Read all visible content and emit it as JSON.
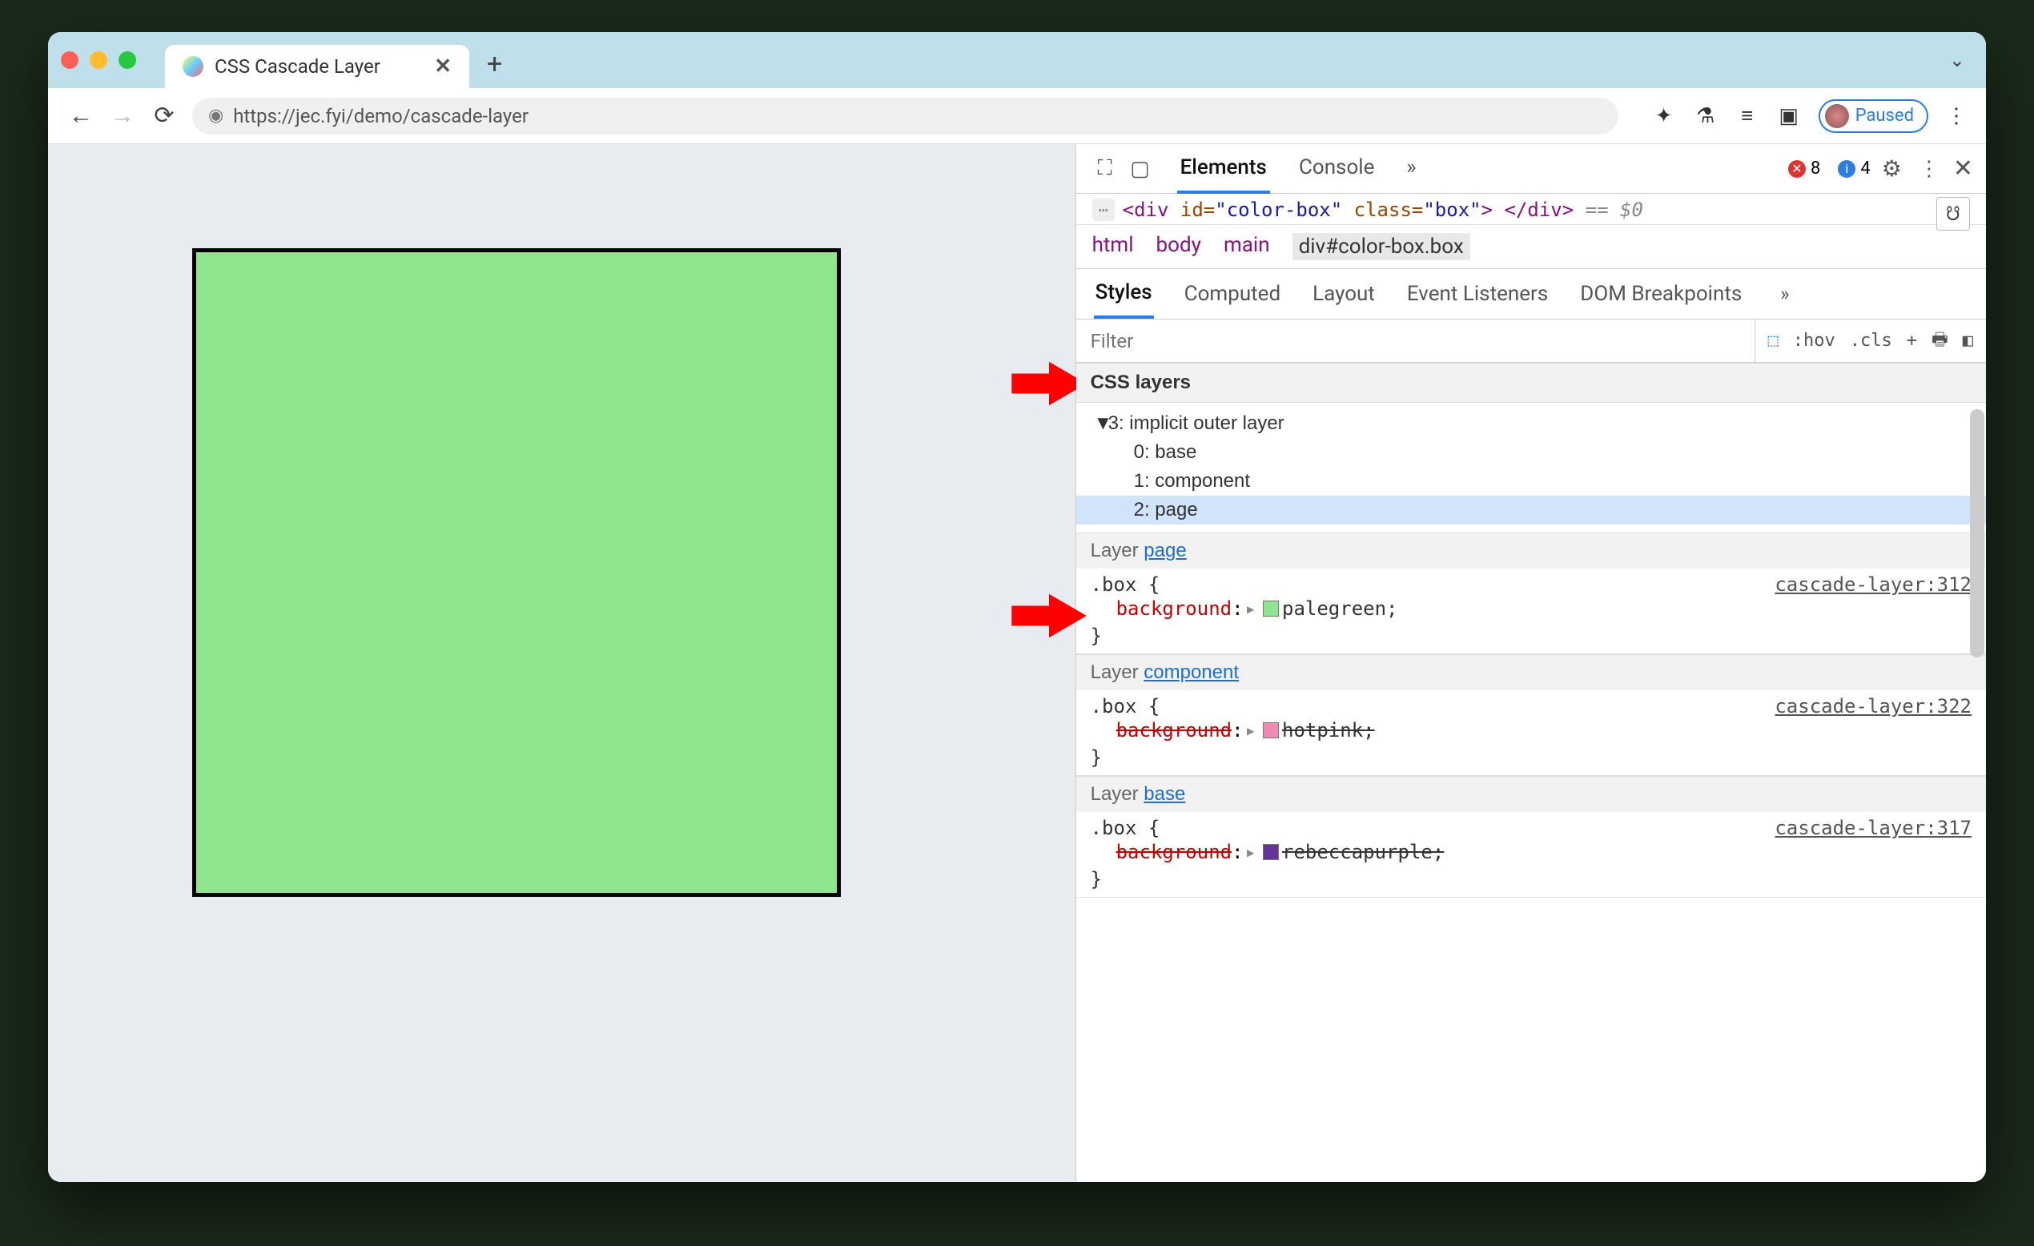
{
  "tab": {
    "title": "CSS Cascade Layer",
    "close": "✕",
    "new": "+"
  },
  "urlbar": {
    "url": "https://jec.fyi/demo/cascade-layer",
    "paused": "Paused"
  },
  "devtools": {
    "tabs": {
      "elements": "Elements",
      "console": "Console"
    },
    "errors": "8",
    "info": "4",
    "more": "»",
    "element_line_prefix": "<div ",
    "element_id_attr": "id=",
    "element_id_val": "\"color-box\"",
    "element_class_attr": " class=",
    "element_class_val": "\"box\"",
    "element_close": "> </div>",
    "eq0": " == $0",
    "breadcrumb": {
      "html": "html",
      "body": "body",
      "main": "main",
      "sel": "div#color-box.box"
    }
  },
  "styles": {
    "tabs": {
      "styles": "Styles",
      "computed": "Computed",
      "layout": "Layout",
      "events": "Event Listeners",
      "dom": "DOM Breakpoints",
      "more": "»"
    },
    "filter_placeholder": "Filter",
    "tools": {
      "hov": ":hov",
      "cls": ".cls",
      "plus": "+"
    },
    "css_layers_header": "CSS layers",
    "layer_tree": {
      "root": "3: implicit outer layer",
      "i0": "0: base",
      "i1": "1: component",
      "i2": "2: page"
    },
    "rules": [
      {
        "layer_label": "Layer ",
        "layer_link": "page",
        "selector": ".box {",
        "source": "cascade-layer:312",
        "prop": "background",
        "value": "palegreen",
        "swatch": "#8ee78e",
        "struck": false
      },
      {
        "layer_label": "Layer ",
        "layer_link": "component",
        "selector": ".box {",
        "source": "cascade-layer:322",
        "prop": "background",
        "value": "hotpink",
        "swatch": "#f08ab4",
        "struck": true
      },
      {
        "layer_label": "Layer ",
        "layer_link": "base",
        "selector": ".box {",
        "source": "cascade-layer:317",
        "prop": "background",
        "value": "rebeccapurple",
        "swatch": "#663399",
        "struck": true
      }
    ]
  }
}
